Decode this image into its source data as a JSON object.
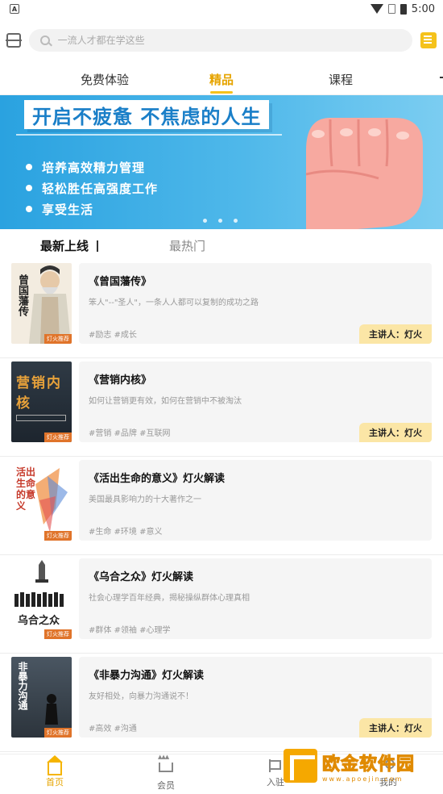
{
  "status_bar": {
    "time": "5:00"
  },
  "search": {
    "placeholder": "一流人才都在学这些"
  },
  "tabs": [
    {
      "label": "免费体验"
    },
    {
      "label": "精品"
    },
    {
      "label": "课程"
    }
  ],
  "banner": {
    "title": "开启不疲惫 不焦虑的人生",
    "points": [
      "培养高效精力管理",
      "轻松胜任高强度工作",
      "享受生活"
    ]
  },
  "subtabs": [
    {
      "label": "最新上线"
    },
    {
      "label": "最热门"
    }
  ],
  "courses": [
    {
      "title": "《曾国藩传》",
      "desc": "笨人\"--\"圣人\"，一条人人都可以复制的成功之路",
      "tags": "#励志 #成长",
      "speaker": "主讲人：灯火",
      "cover_text": "曾国藩传",
      "cover_label": "灯火推荐"
    },
    {
      "title": "《营销内核》",
      "desc": "如何让营销更有效，如何在营销中不被淘汰",
      "tags": "#营销 #品牌 #互联网",
      "speaker": "主讲人：灯火",
      "cover_text": "营销内核",
      "cover_label": "灯火推荐"
    },
    {
      "title": "《活出生命的意义》灯火解读",
      "desc": "美国最具影响力的十大著作之一",
      "tags": "#生命 #环境 #意义",
      "speaker": "",
      "cover_text": "活出生命的意义",
      "cover_label": "灯火推荐"
    },
    {
      "title": "《乌合之众》灯火解读",
      "desc": "社会心理学百年经典，揭秘操纵群体心理真相",
      "tags": "#群体 #领袖 #心理学",
      "speaker": "",
      "cover_text": "乌合之众",
      "cover_label": "灯火推荐"
    },
    {
      "title": "《非暴力沟通》灯火解读",
      "desc": "友好相处，向暴力沟通说不！",
      "tags": "#高效 #沟通",
      "speaker": "主讲人：灯火",
      "cover_text": "非暴力沟通",
      "cover_label": "灯火推荐"
    }
  ],
  "bottom_nav": [
    {
      "label": "首页"
    },
    {
      "label": "会员"
    },
    {
      "label": "入驻"
    },
    {
      "label": "我的"
    }
  ],
  "watermark": {
    "text": "欧金软件园",
    "sub": "www.apoejin.com"
  },
  "colors": {
    "accent": "#f5c21b",
    "banner": "#2aa2e0",
    "speaker_bg": "#fbe6a6"
  }
}
